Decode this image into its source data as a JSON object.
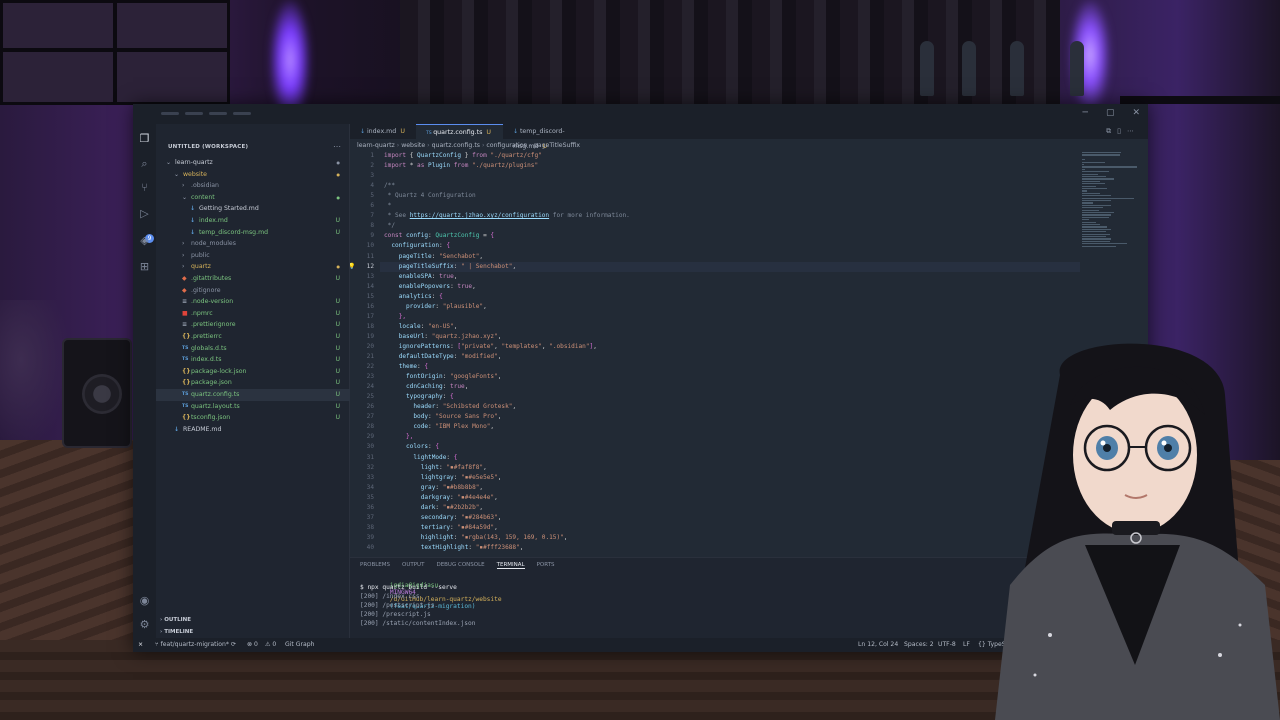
{
  "colors": {
    "keyword": "#c586c0",
    "ident": "#9cdcfe",
    "string": "#ce9178",
    "type": "#4ec9b0",
    "comment": "#7f8a9a",
    "punct": "#d4d4d4",
    "brace": "#da70d6",
    "link": "#9cdcfe",
    "accent": "#5b8def"
  },
  "activity_bar": {
    "icons": [
      "files-icon",
      "search-icon",
      "source-control-icon",
      "run-debug-icon",
      "extensions-icon",
      "remote-icon",
      "account-icon",
      "settings-icon"
    ],
    "badge": "9"
  },
  "explorer": {
    "title": "UNTITLED (WORKSPACE)",
    "items": [
      {
        "label": "learn-quartz",
        "depth": 0,
        "kind": "folder-open",
        "git": "●",
        "gitColor": "#8a93a4",
        "color": "#c7ccd6"
      },
      {
        "label": "website",
        "depth": 1,
        "kind": "folder-open",
        "git": "●",
        "gitColor": "#d6b25a",
        "color": "#d6b25a"
      },
      {
        "label": ".obsidian",
        "depth": 2,
        "kind": "folder",
        "git": "",
        "gitColor": "#8a93a4",
        "color": "#8a93a4"
      },
      {
        "label": "content",
        "depth": 2,
        "kind": "folder-open",
        "git": "●",
        "gitColor": "#7bc47f",
        "color": "#7bc47f"
      },
      {
        "label": "Getting Started.md",
        "depth": 3,
        "kind": "file",
        "icon": "↓",
        "iconColor": "#5b9bd5",
        "git": "",
        "gitColor": "#8a93a4",
        "color": "#c7ccd6"
      },
      {
        "label": "index.md",
        "depth": 3,
        "kind": "file",
        "icon": "↓",
        "iconColor": "#5b9bd5",
        "git": "U",
        "gitColor": "#7bc47f",
        "color": "#7bc47f"
      },
      {
        "label": "temp_discord-msg.md",
        "depth": 3,
        "kind": "file",
        "icon": "↓",
        "iconColor": "#5b9bd5",
        "git": "U",
        "gitColor": "#7bc47f",
        "color": "#7bc47f"
      },
      {
        "label": "node_modules",
        "depth": 2,
        "kind": "folder",
        "git": "",
        "gitColor": "#8a93a4",
        "color": "#8a93a4"
      },
      {
        "label": "public",
        "depth": 2,
        "kind": "folder",
        "git": "",
        "gitColor": "#8a93a4",
        "color": "#8a93a4"
      },
      {
        "label": "quartz",
        "depth": 2,
        "kind": "folder",
        "git": "●",
        "gitColor": "#d6b25a",
        "color": "#d6b25a"
      },
      {
        "label": ".gitattributes",
        "depth": 2,
        "kind": "file",
        "icon": "◆",
        "iconColor": "#e06c4a",
        "git": "U",
        "gitColor": "#7bc47f",
        "color": "#7bc47f"
      },
      {
        "label": ".gitignore",
        "depth": 2,
        "kind": "file",
        "icon": "◆",
        "iconColor": "#e06c4a",
        "git": "",
        "gitColor": "#8a93a4",
        "color": "#8a93a4"
      },
      {
        "label": ".node-version",
        "depth": 2,
        "kind": "file",
        "icon": "≡",
        "iconColor": "#9aa3b3",
        "git": "U",
        "gitColor": "#7bc47f",
        "color": "#7bc47f"
      },
      {
        "label": ".npmrc",
        "depth": 2,
        "kind": "file",
        "icon": "■",
        "iconColor": "#e0443a",
        "git": "U",
        "gitColor": "#7bc47f",
        "color": "#7bc47f"
      },
      {
        "label": ".prettierignore",
        "depth": 2,
        "kind": "file",
        "icon": "≡",
        "iconColor": "#9aa3b3",
        "git": "U",
        "gitColor": "#7bc47f",
        "color": "#7bc47f"
      },
      {
        "label": ".prettierrc",
        "depth": 2,
        "kind": "file",
        "icon": "{}",
        "iconColor": "#d6b25a",
        "git": "U",
        "gitColor": "#7bc47f",
        "color": "#7bc47f"
      },
      {
        "label": "globals.d.ts",
        "depth": 2,
        "kind": "file",
        "icon": "TS",
        "iconColor": "#5b9bd5",
        "git": "U",
        "gitColor": "#7bc47f",
        "color": "#7bc47f"
      },
      {
        "label": "index.d.ts",
        "depth": 2,
        "kind": "file",
        "icon": "TS",
        "iconColor": "#5b9bd5",
        "git": "U",
        "gitColor": "#7bc47f",
        "color": "#7bc47f"
      },
      {
        "label": "package-lock.json",
        "depth": 2,
        "kind": "file",
        "icon": "{}",
        "iconColor": "#d6b25a",
        "git": "U",
        "gitColor": "#7bc47f",
        "color": "#7bc47f"
      },
      {
        "label": "package.json",
        "depth": 2,
        "kind": "file",
        "icon": "{}",
        "iconColor": "#d6b25a",
        "git": "U",
        "gitColor": "#7bc47f",
        "color": "#7bc47f"
      },
      {
        "label": "quartz.config.ts",
        "depth": 2,
        "kind": "file",
        "icon": "TS",
        "iconColor": "#5b9bd5",
        "git": "U",
        "gitColor": "#7bc47f",
        "color": "#7bc47f",
        "selected": true
      },
      {
        "label": "quartz.layout.ts",
        "depth": 2,
        "kind": "file",
        "icon": "TS",
        "iconColor": "#5b9bd5",
        "git": "U",
        "gitColor": "#7bc47f",
        "color": "#7bc47f"
      },
      {
        "label": "tsconfig.json",
        "depth": 2,
        "kind": "file",
        "icon": "{}",
        "iconColor": "#d6b25a",
        "git": "U",
        "gitColor": "#7bc47f",
        "color": "#7bc47f"
      },
      {
        "label": "README.md",
        "depth": 1,
        "kind": "file",
        "icon": "↓",
        "iconColor": "#5b9bd5",
        "git": "",
        "gitColor": "#8a93a4",
        "color": "#c7ccd6"
      }
    ],
    "outline_label": "OUTLINE",
    "timeline_label": "TIMELINE"
  },
  "tabs": [
    {
      "icon": "↓",
      "label": "index.md",
      "mod": "U",
      "active": false
    },
    {
      "icon": "TS",
      "label": "quartz.config.ts",
      "mod": "U",
      "active": true
    },
    {
      "icon": "↓",
      "label": "temp_discord-msg.md",
      "mod": "U",
      "active": false
    }
  ],
  "breadcrumb": [
    "learn-quartz",
    "website",
    "quartz.config.ts",
    "configuration",
    "pageTitleSuffix"
  ],
  "editor": {
    "current_line": 12,
    "lines": [
      [
        [
          "keyword",
          "import "
        ],
        [
          "punct",
          "{ "
        ],
        [
          "ident",
          "QuartzConfig"
        ],
        [
          "punct",
          " } "
        ],
        [
          "keyword",
          "from "
        ],
        [
          "string",
          "\"./quartz/cfg\""
        ]
      ],
      [
        [
          "keyword",
          "import "
        ],
        [
          "punct",
          "* "
        ],
        [
          "keyword",
          "as "
        ],
        [
          "ident",
          "Plugin "
        ],
        [
          "keyword",
          "from "
        ],
        [
          "string",
          "\"./quartz/plugins\""
        ]
      ],
      [],
      [
        [
          "comment",
          "/**"
        ]
      ],
      [
        [
          "comment",
          " * Quartz 4 Configuration"
        ]
      ],
      [
        [
          "comment",
          " *"
        ]
      ],
      [
        [
          "comment",
          " * See "
        ],
        [
          "link",
          "https://quartz.jzhao.xyz/configuration"
        ],
        [
          "comment",
          " for more information."
        ]
      ],
      [
        [
          "comment",
          " */"
        ]
      ],
      [
        [
          "keyword",
          "const "
        ],
        [
          "ident",
          "config"
        ],
        [
          "punct",
          ": "
        ],
        [
          "type",
          "QuartzConfig"
        ],
        [
          "punct",
          " = "
        ],
        [
          "brace",
          "{"
        ]
      ],
      [
        [
          "punct",
          "  "
        ],
        [
          "ident",
          "configuration"
        ],
        [
          "punct",
          ": "
        ],
        [
          "brace",
          "{"
        ]
      ],
      [
        [
          "punct",
          "    "
        ],
        [
          "ident",
          "pageTitle"
        ],
        [
          "punct",
          ": "
        ],
        [
          "string",
          "\"Senchabot\""
        ],
        [
          "punct",
          ","
        ]
      ],
      [
        [
          "punct",
          "    "
        ],
        [
          "ident",
          "pageTitleSuffix"
        ],
        [
          "punct",
          ": "
        ],
        [
          "string",
          "\" | Senchabot\""
        ],
        [
          "punct",
          ","
        ]
      ],
      [
        [
          "punct",
          "    "
        ],
        [
          "ident",
          "enableSPA"
        ],
        [
          "punct",
          ": "
        ],
        [
          "keyword",
          "true"
        ],
        [
          "punct",
          ","
        ]
      ],
      [
        [
          "punct",
          "    "
        ],
        [
          "ident",
          "enablePopovers"
        ],
        [
          "punct",
          ": "
        ],
        [
          "keyword",
          "true"
        ],
        [
          "punct",
          ","
        ]
      ],
      [
        [
          "punct",
          "    "
        ],
        [
          "ident",
          "analytics"
        ],
        [
          "punct",
          ": "
        ],
        [
          "brace",
          "{"
        ]
      ],
      [
        [
          "punct",
          "      "
        ],
        [
          "ident",
          "provider"
        ],
        [
          "punct",
          ": "
        ],
        [
          "string",
          "\"plausible\""
        ],
        [
          "punct",
          ","
        ]
      ],
      [
        [
          "punct",
          "    "
        ],
        [
          "brace",
          "},"
        ]
      ],
      [
        [
          "punct",
          "    "
        ],
        [
          "ident",
          "locale"
        ],
        [
          "punct",
          ": "
        ],
        [
          "string",
          "\"en-US\""
        ],
        [
          "punct",
          ","
        ]
      ],
      [
        [
          "punct",
          "    "
        ],
        [
          "ident",
          "baseUrl"
        ],
        [
          "punct",
          ": "
        ],
        [
          "string",
          "\"quartz.jzhao.xyz\""
        ],
        [
          "punct",
          ","
        ]
      ],
      [
        [
          "punct",
          "    "
        ],
        [
          "ident",
          "ignorePatterns"
        ],
        [
          "punct",
          ": "
        ],
        [
          "brace",
          "["
        ],
        [
          "string",
          "\"private\""
        ],
        [
          "punct",
          ", "
        ],
        [
          "string",
          "\"templates\""
        ],
        [
          "punct",
          ", "
        ],
        [
          "string",
          "\".obsidian\""
        ],
        [
          "brace",
          "]"
        ],
        [
          "punct",
          ","
        ]
      ],
      [
        [
          "punct",
          "    "
        ],
        [
          "ident",
          "defaultDateType"
        ],
        [
          "punct",
          ": "
        ],
        [
          "string",
          "\"modified\""
        ],
        [
          "punct",
          ","
        ]
      ],
      [
        [
          "punct",
          "    "
        ],
        [
          "ident",
          "theme"
        ],
        [
          "punct",
          ": "
        ],
        [
          "brace",
          "{"
        ]
      ],
      [
        [
          "punct",
          "      "
        ],
        [
          "ident",
          "fontOrigin"
        ],
        [
          "punct",
          ": "
        ],
        [
          "string",
          "\"googleFonts\""
        ],
        [
          "punct",
          ","
        ]
      ],
      [
        [
          "punct",
          "      "
        ],
        [
          "ident",
          "cdnCaching"
        ],
        [
          "punct",
          ": "
        ],
        [
          "keyword",
          "true"
        ],
        [
          "punct",
          ","
        ]
      ],
      [
        [
          "punct",
          "      "
        ],
        [
          "ident",
          "typography"
        ],
        [
          "punct",
          ": "
        ],
        [
          "brace",
          "{"
        ]
      ],
      [
        [
          "punct",
          "        "
        ],
        [
          "ident",
          "header"
        ],
        [
          "punct",
          ": "
        ],
        [
          "string",
          "\"Schibsted Grotesk\""
        ],
        [
          "punct",
          ","
        ]
      ],
      [
        [
          "punct",
          "        "
        ],
        [
          "ident",
          "body"
        ],
        [
          "punct",
          ": "
        ],
        [
          "string",
          "\"Source Sans Pro\""
        ],
        [
          "punct",
          ","
        ]
      ],
      [
        [
          "punct",
          "        "
        ],
        [
          "ident",
          "code"
        ],
        [
          "punct",
          ": "
        ],
        [
          "string",
          "\"IBM Plex Mono\""
        ],
        [
          "punct",
          ","
        ]
      ],
      [
        [
          "punct",
          "      "
        ],
        [
          "brace",
          "},"
        ]
      ],
      [
        [
          "punct",
          "      "
        ],
        [
          "ident",
          "colors"
        ],
        [
          "punct",
          ": "
        ],
        [
          "brace",
          "{"
        ]
      ],
      [
        [
          "punct",
          "        "
        ],
        [
          "ident",
          "lightMode"
        ],
        [
          "punct",
          ": "
        ],
        [
          "brace",
          "{"
        ]
      ],
      [
        [
          "punct",
          "          "
        ],
        [
          "ident",
          "light"
        ],
        [
          "punct",
          ": "
        ],
        [
          "string",
          "\"▪#faf8f8\""
        ],
        [
          "punct",
          ","
        ]
      ],
      [
        [
          "punct",
          "          "
        ],
        [
          "ident",
          "lightgray"
        ],
        [
          "punct",
          ": "
        ],
        [
          "string",
          "\"▪#e5e5e5\""
        ],
        [
          "punct",
          ","
        ]
      ],
      [
        [
          "punct",
          "          "
        ],
        [
          "ident",
          "gray"
        ],
        [
          "punct",
          ": "
        ],
        [
          "string",
          "\"▪#b8b8b8\""
        ],
        [
          "punct",
          ","
        ]
      ],
      [
        [
          "punct",
          "          "
        ],
        [
          "ident",
          "darkgray"
        ],
        [
          "punct",
          ": "
        ],
        [
          "string",
          "\"▪#4e4e4e\""
        ],
        [
          "punct",
          ","
        ]
      ],
      [
        [
          "punct",
          "          "
        ],
        [
          "ident",
          "dark"
        ],
        [
          "punct",
          ": "
        ],
        [
          "string",
          "\"▪#2b2b2b\""
        ],
        [
          "punct",
          ","
        ]
      ],
      [
        [
          "punct",
          "          "
        ],
        [
          "ident",
          "secondary"
        ],
        [
          "punct",
          ": "
        ],
        [
          "string",
          "\"▪#284b63\""
        ],
        [
          "punct",
          ","
        ]
      ],
      [
        [
          "punct",
          "          "
        ],
        [
          "ident",
          "tertiary"
        ],
        [
          "punct",
          ": "
        ],
        [
          "string",
          "\"▪#84a59d\""
        ],
        [
          "punct",
          ","
        ]
      ],
      [
        [
          "punct",
          "          "
        ],
        [
          "ident",
          "highlight"
        ],
        [
          "punct",
          ": "
        ],
        [
          "string",
          "\"▪rgba(143, 159, 169, 0.15)\""
        ],
        [
          "punct",
          ","
        ]
      ],
      [
        [
          "punct",
          "          "
        ],
        [
          "ident",
          "textHighlight"
        ],
        [
          "punct",
          ": "
        ],
        [
          "string",
          "\"▪#fff23688\""
        ],
        [
          "punct",
          ","
        ]
      ]
    ]
  },
  "panel": {
    "tabs": [
      "PROBLEMS",
      "OUTPUT",
      "DEBUG CONSOLE",
      "TERMINAL",
      "PORTS"
    ],
    "active_tab": "TERMINAL",
    "terminal": {
      "prompt_user": "igdia@igdiasu",
      "prompt_shell": "MINGW64",
      "prompt_path": "/d/GitHub/learn-quartz/website",
      "prompt_branch": "(feat/quartz-migration)",
      "command": "$ npx quartz build --serve",
      "output": [
        "[200] /index.css",
        "[200] /postscript.js",
        "[200] /prescript.js",
        "[200] /static/contentIndex.json"
      ]
    }
  },
  "statusbar": {
    "remote": "⨯",
    "branch": "feat/quartz-migration*",
    "sync": "⟳",
    "errors": "⊗ 0",
    "warnings": "⚠ 0",
    "git_graph": "Git Graph",
    "position": "Ln 12, Col 24",
    "spaces": "Spaces: 2",
    "encoding": "UTF-8",
    "eol": "LF",
    "language": "TypeScri"
  }
}
